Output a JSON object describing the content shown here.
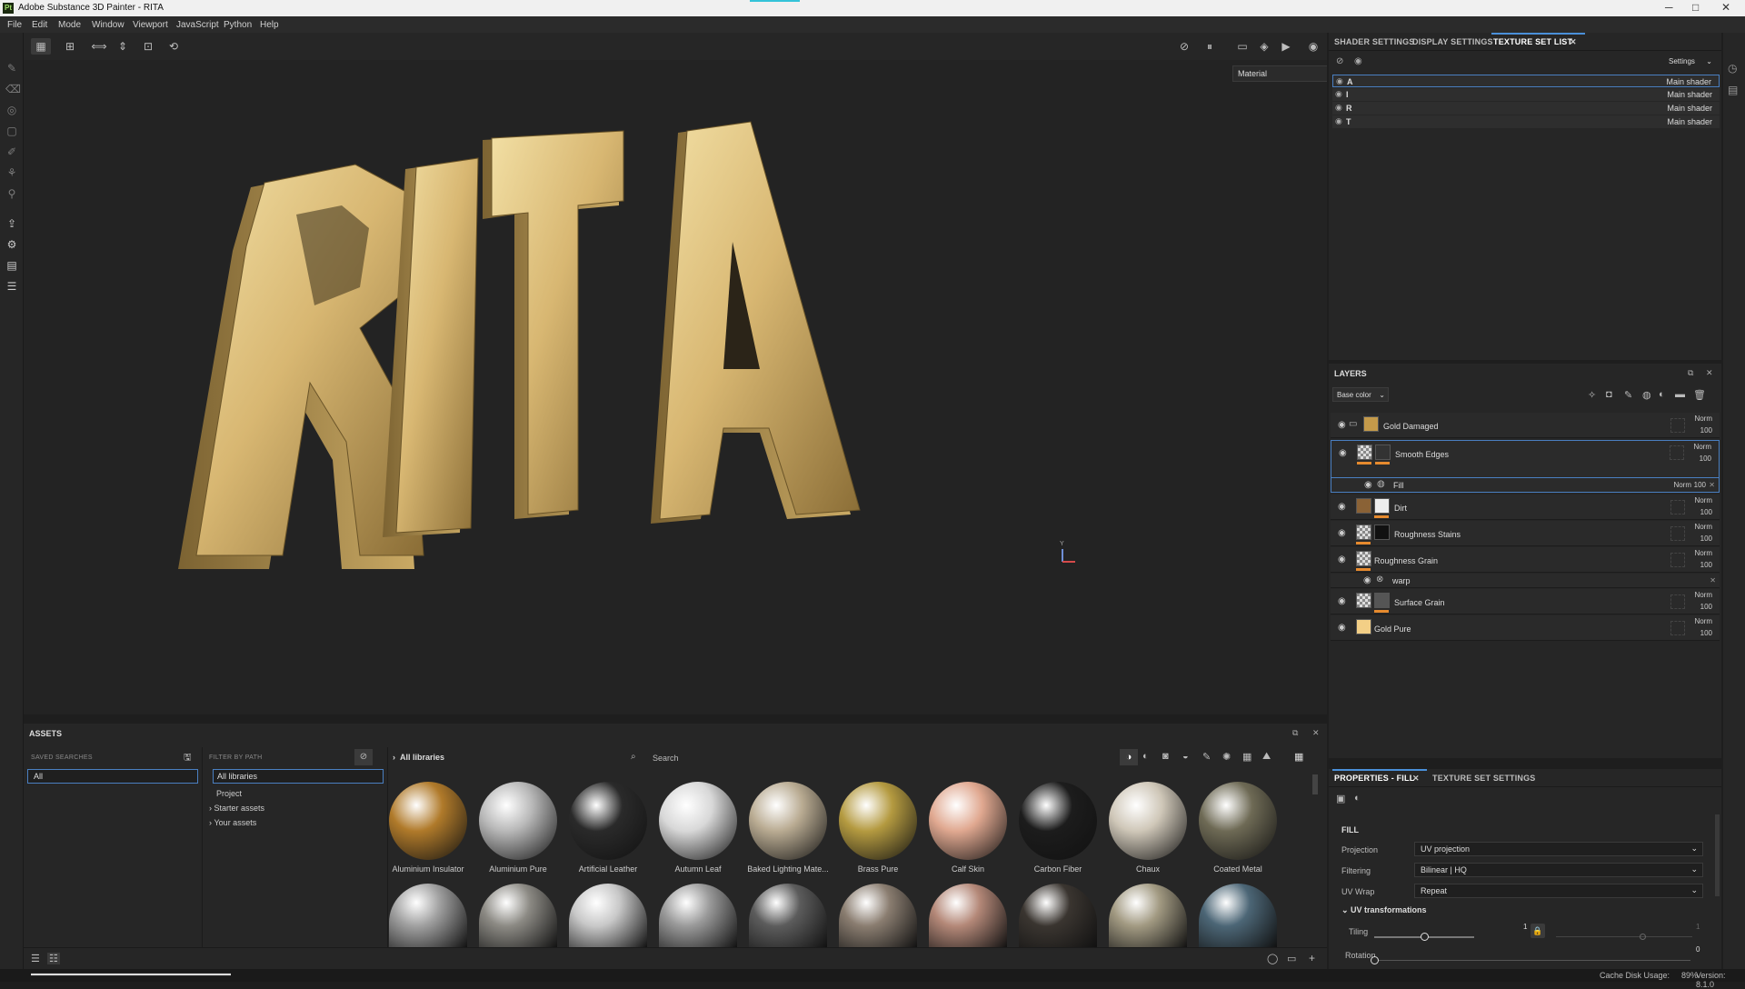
{
  "window": {
    "title": "Adobe Substance 3D Painter - RITA",
    "logo": "Pt"
  },
  "window_buttons": {
    "minimize": "─",
    "maximize": "□",
    "close": "✕"
  },
  "menu": [
    "File",
    "Edit",
    "Mode",
    "Window",
    "Viewport",
    "JavaScript",
    "Python",
    "Help"
  ],
  "viewport": {
    "display_mode": "Material",
    "model_text": "RITA",
    "axis_label": "Y"
  },
  "texture_set_panel": {
    "tabs": [
      "SHADER SETTINGS",
      "DISPLAY SETTINGS",
      "TEXTURE SET LIST"
    ],
    "active_tab": "TEXTURE SET LIST",
    "settings_label": "Settings",
    "rows": [
      {
        "name": "A",
        "shader": "Main shader"
      },
      {
        "name": "I",
        "shader": "Main shader"
      },
      {
        "name": "R",
        "shader": "Main shader"
      },
      {
        "name": "T",
        "shader": "Main shader"
      }
    ]
  },
  "layers": {
    "title": "LAYERS",
    "channel": "Base color",
    "items": [
      {
        "name": "Gold Damaged",
        "blend": "Norm",
        "opacity": "100"
      },
      {
        "name": "Smooth Edges",
        "blend": "Norm",
        "opacity": "100"
      },
      {
        "name": "Fill",
        "blend": "Norm",
        "opacity": "100"
      },
      {
        "name": "Dirt",
        "blend": "Norm",
        "opacity": "100"
      },
      {
        "name": "Roughness Stains",
        "blend": "Norm",
        "opacity": "100"
      },
      {
        "name": "Roughness Grain",
        "blend": "Norm",
        "opacity": "100"
      },
      {
        "name": "warp",
        "blend": "",
        "opacity": ""
      },
      {
        "name": "Surface Grain",
        "blend": "Norm",
        "opacity": "100"
      },
      {
        "name": "Gold Pure",
        "blend": "Norm",
        "opacity": "100"
      }
    ]
  },
  "properties": {
    "tabs": [
      "PROPERTIES - FILL",
      "TEXTURE SET SETTINGS"
    ],
    "section": "FILL",
    "projection": {
      "label": "Projection",
      "value": "UV projection"
    },
    "filtering": {
      "label": "Filtering",
      "value": "Bilinear | HQ"
    },
    "uv_wrap": {
      "label": "UV Wrap",
      "value": "Repeat"
    },
    "uv_transformations": "UV transformations",
    "tiling": {
      "label": "Tiling",
      "value": "1",
      "secondary": "1",
      "slider": 0.5
    },
    "rotation": {
      "label": "Rotation",
      "value": "0",
      "slider": 0.0
    }
  },
  "assets": {
    "title": "ASSETS",
    "saved_searches_label": "SAVED SEARCHES",
    "saved_search_value": "All",
    "filter_by_path_label": "FILTER BY PATH",
    "path_tree": [
      "All libraries",
      "Project",
      "Starter assets",
      "Your assets"
    ],
    "breadcrumb": "All libraries",
    "search_placeholder": "Search",
    "row1": [
      {
        "name": "Aluminium Insulator",
        "color": "#b07a2a"
      },
      {
        "name": "Aluminium Pure",
        "color": "#b8b8b8"
      },
      {
        "name": "Artificial Leather",
        "color": "#2a2a2a"
      },
      {
        "name": "Autumn Leaf",
        "color": "#d8d8d8"
      },
      {
        "name": "Baked Lighting Mate...",
        "color": "#b9ab92"
      },
      {
        "name": "Brass Pure",
        "color": "#b49a40"
      },
      {
        "name": "Calf Skin",
        "color": "#e0a890"
      },
      {
        "name": "Carbon Fiber",
        "color": "#1c1c1c"
      },
      {
        "name": "Chaux",
        "color": "#cfc7b8"
      },
      {
        "name": "Coated Metal",
        "color": "#6e6a55"
      }
    ],
    "row2_colors": [
      "#a0a0a0",
      "#8c8a84",
      "#c8c8c8",
      "#9a9a9a",
      "#5c5c5c",
      "#8a7d70",
      "#b48878",
      "#3a3530",
      "#a29a82",
      "#4c6676"
    ]
  },
  "status": {
    "cache": "Cache Disk Usage:",
    "cache_value": "89%",
    "version": "Version: 8.1.0"
  }
}
